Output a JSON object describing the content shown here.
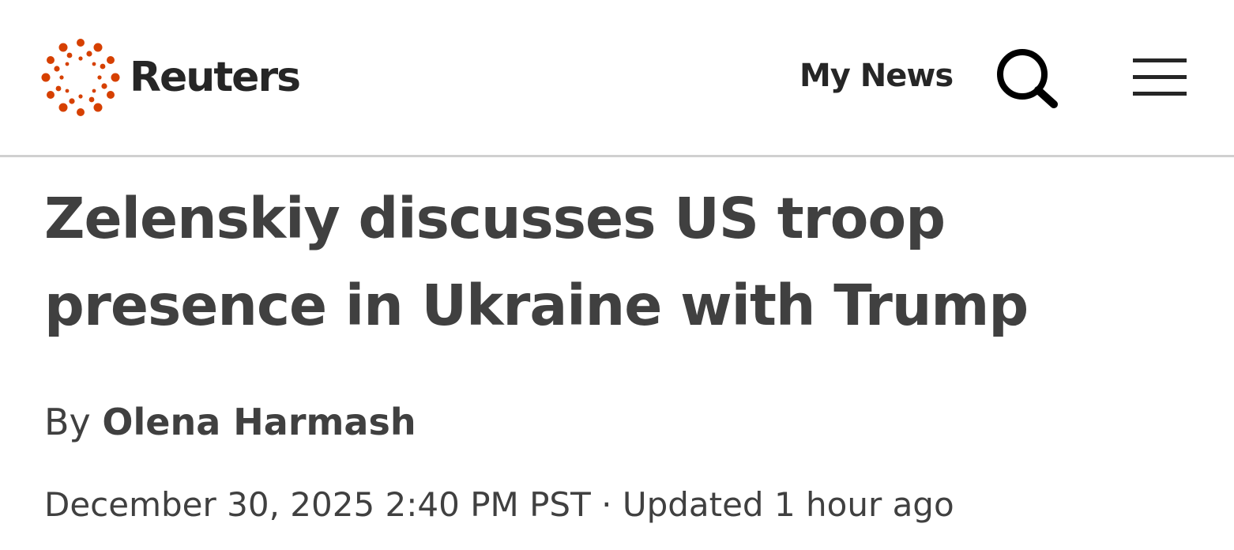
{
  "header": {
    "logo_text": "Reuters",
    "my_news_label": "My News",
    "search_icon": "search-icon",
    "menu_icon": "hamburger-menu-icon",
    "brand_color": "#d64000"
  },
  "article": {
    "headline": "Zelenskiy discusses US troop presence in Ukraine with Trump",
    "byline_prefix": "By",
    "author": "Olena Harmash",
    "date": "December 30, 2025 2:40 PM PST",
    "separator": "·",
    "updated": "Updated 1 hour ago"
  }
}
